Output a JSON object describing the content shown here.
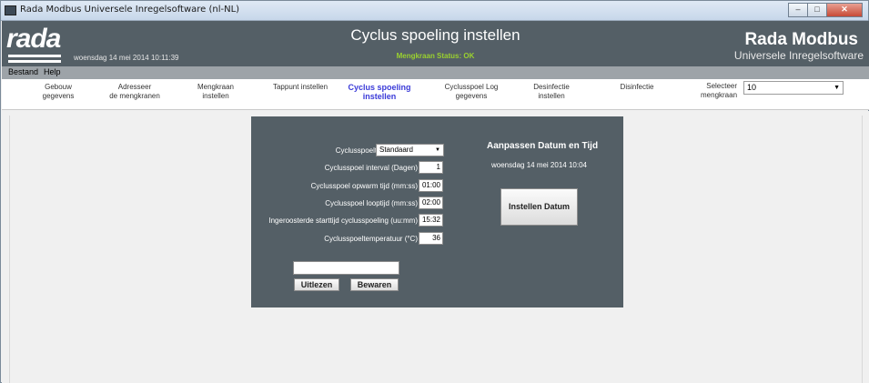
{
  "window": {
    "title": "Rada Modbus Universele Inregelsoftware (nl-NL)"
  },
  "header": {
    "logo_text": "rada",
    "date_time": "woensdag 14 mei 2014 10:11:39",
    "page_title": "Cyclus spoeling instellen",
    "status": "Mengkraan Status: OK",
    "brand_line1": "Rada Modbus",
    "brand_line2": "Universele Inregelsoftware"
  },
  "menu": {
    "bestand": "Bestand",
    "help": "Help"
  },
  "nav": {
    "items": [
      {
        "line1": "Gebouw",
        "line2": "gegevens"
      },
      {
        "line1": "Adresseer",
        "line2": "de mengkranen"
      },
      {
        "line1": "Mengkraan",
        "line2": "instellen"
      },
      {
        "line1": "Tappunt instellen",
        "line2": ""
      },
      {
        "line1": "Cyclus spoeling",
        "line2": "instellen"
      },
      {
        "line1": "Cyclusspoel Log",
        "line2": "gegevens"
      },
      {
        "line1": "Desinfectie",
        "line2": "instellen"
      },
      {
        "line1": "Disinfectie",
        "line2": ""
      }
    ],
    "selecteer_label1": "Selecteer",
    "selecteer_label2": "mengkraan",
    "selecteer_value": "10"
  },
  "form": {
    "type_label": "Cyclusspoeltype",
    "type_value": "Standaard",
    "interval_label": "Cyclusspoel interval (Dagen)",
    "interval_value": "1",
    "opwarm_label": "Cyclusspoel opwarm tijd (mm:ss)",
    "opwarm_value": "01:00",
    "looptijd_label": "Cyclusspoel looptijd (mm:ss)",
    "looptijd_value": "02:00",
    "starttijd_label": "Ingeroosterde starttijd cyclusspoeling (uu:mm)",
    "starttijd_value": "15:32",
    "temp_label": "Cyclusspoeltemperatuur (°C)",
    "temp_value": "36",
    "status_value": "",
    "uitlezen_label": "Uitlezen",
    "bewaren_label": "Bewaren"
  },
  "datetime_panel": {
    "heading": "Aanpassen Datum en Tijd",
    "current": "woensdag 14 mei 2014 10:04",
    "button_label": "Instellen Datum"
  },
  "colors": {
    "header_bg": "#545f66",
    "status_green": "#9ad12f",
    "active_nav": "#3a3ad8"
  }
}
